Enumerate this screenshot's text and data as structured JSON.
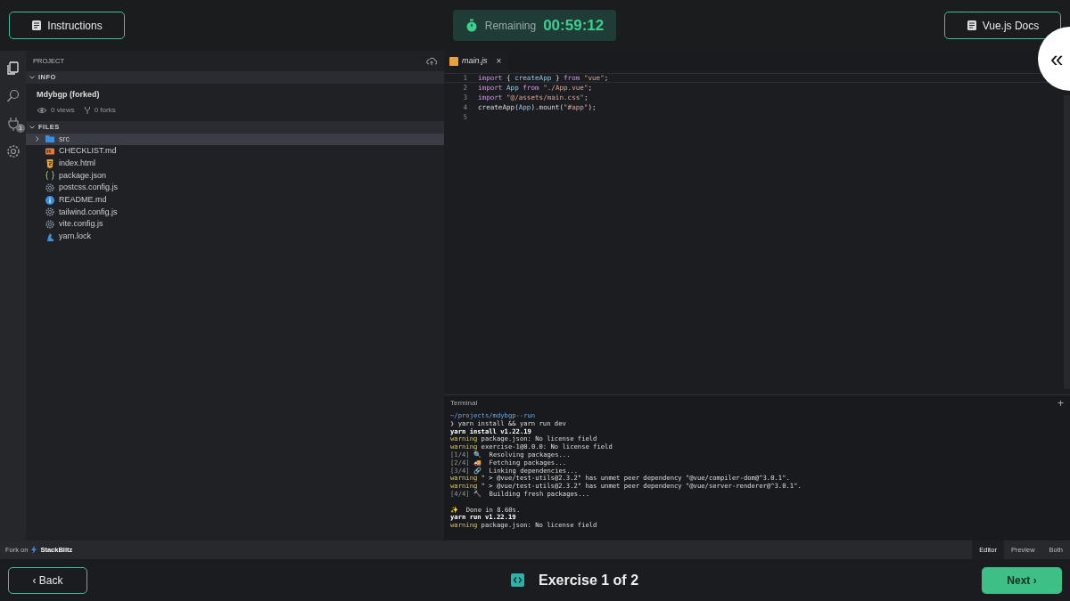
{
  "header": {
    "instructions_button": "Instructions",
    "timer_label": "Remaining",
    "timer_value": "00:59:12",
    "docs_button": "Vue.js Docs",
    "collapse_button": "«"
  },
  "activity_bar": [
    {
      "kind": "files",
      "selected": true
    },
    {
      "kind": "search",
      "selected": false
    },
    {
      "kind": "plug",
      "selected": false,
      "badge": "1"
    },
    {
      "kind": "settings",
      "selected": false
    }
  ],
  "explorer": {
    "title": "PROJECT",
    "sections": [
      {
        "label": "INFO",
        "expanded": true
      },
      {
        "label": "FILES",
        "expanded": true
      }
    ],
    "info": {
      "name": "Mdybgp (forked)",
      "views": "0 views",
      "forks": "0 forks"
    },
    "files": [
      {
        "name": "src",
        "kind": "folder",
        "expanded": false,
        "selected": true
      },
      {
        "name": "CHECKLIST.md",
        "kind": "markdown",
        "selected": false
      },
      {
        "name": "index.html",
        "kind": "html",
        "selected": false
      },
      {
        "name": "package.json",
        "kind": "json",
        "selected": false
      },
      {
        "name": "postcss.config.js",
        "kind": "config",
        "selected": false
      },
      {
        "name": "README.md",
        "kind": "info",
        "selected": false
      },
      {
        "name": "tailwind.config.js",
        "kind": "config",
        "selected": false
      },
      {
        "name": "vite.config.js",
        "kind": "config",
        "selected": false
      },
      {
        "name": "yarn.lock",
        "kind": "yarn",
        "selected": false
      }
    ]
  },
  "editor": {
    "tabs": [
      {
        "label": "main.js",
        "selected": true,
        "close": "×"
      }
    ],
    "lines": [
      {
        "number": "1",
        "tokens": [
          {
            "kind": "keyword",
            "text": "import"
          },
          {
            "kind": "plain",
            "text": " { "
          },
          {
            "kind": "name",
            "text": "createApp"
          },
          {
            "kind": "plain",
            "text": " } "
          },
          {
            "kind": "keyword",
            "text": "from"
          },
          {
            "kind": "string",
            "text": " \"vue\""
          },
          {
            "kind": "plain",
            "text": ";"
          }
        ]
      },
      {
        "number": "2",
        "tokens": [
          {
            "kind": "keyword",
            "text": "import"
          },
          {
            "kind": "name",
            "text": " App"
          },
          {
            "kind": "keyword",
            "text": " from"
          },
          {
            "kind": "string",
            "text": " \"./App.vue\""
          },
          {
            "kind": "plain",
            "text": ";"
          }
        ]
      },
      {
        "number": "3",
        "tokens": [
          {
            "kind": "keyword",
            "text": "import"
          },
          {
            "kind": "string",
            "text": " \"@/assets/main.css\""
          },
          {
            "kind": "plain",
            "text": ";"
          }
        ]
      },
      {
        "number": "4",
        "tokens": [
          {
            "kind": "plain",
            "text": "createApp("
          },
          {
            "kind": "name",
            "text": "App"
          },
          {
            "kind": "plain",
            "text": ").mount("
          },
          {
            "kind": "string",
            "text": "\"#app\""
          },
          {
            "kind": "plain",
            "text": ");"
          }
        ]
      },
      {
        "number": "5"
      }
    ]
  },
  "terminal": {
    "title": "Terminal",
    "add_button": "+",
    "lines": [
      {
        "tokens": [
          {
            "kind": "path",
            "text": "~/projects/mdybgp--run"
          }
        ]
      },
      {
        "tokens": [
          {
            "kind": "prompt",
            "text": "❯"
          },
          {
            "kind": "plain",
            "text": " yarn install && yarn run dev"
          }
        ]
      },
      {
        "tokens": [
          {
            "kind": "bold",
            "text": "yarn install v1.22.19"
          }
        ]
      },
      {
        "tokens": [
          {
            "kind": "warning",
            "text": "warning"
          },
          {
            "kind": "plain",
            "text": " package.json: No license field"
          }
        ]
      },
      {
        "tokens": [
          {
            "kind": "warning",
            "text": "warning"
          },
          {
            "kind": "plain",
            "text": " exercise-1@0.0.0: No license field"
          }
        ]
      },
      {
        "tokens": [
          {
            "kind": "dim",
            "text": "[1/4]"
          },
          {
            "kind": "plain",
            "text": " 🔍  Resolving packages..."
          }
        ]
      },
      {
        "tokens": [
          {
            "kind": "dim",
            "text": "[2/4]"
          },
          {
            "kind": "plain",
            "text": " 🚚  Fetching packages..."
          }
        ]
      },
      {
        "tokens": [
          {
            "kind": "dim",
            "text": "[3/4]"
          },
          {
            "kind": "plain",
            "text": " 🔗  Linking dependencies..."
          }
        ]
      },
      {
        "tokens": [
          {
            "kind": "warning",
            "text": "warning"
          },
          {
            "kind": "plain",
            "text": " \" > @vue/test-utils@2.3.2\" has unmet peer dependency \"@vue/compiler-dom@^3.0.1\"."
          }
        ]
      },
      {
        "tokens": [
          {
            "kind": "warning",
            "text": "warning"
          },
          {
            "kind": "plain",
            "text": " \" > @vue/test-utils@2.3.2\" has unmet peer dependency \"@vue/server-renderer@^3.0.1\"."
          }
        ]
      },
      {
        "tokens": [
          {
            "kind": "dim",
            "text": "[4/4]"
          },
          {
            "kind": "plain",
            "text": " 🔨  Building fresh packages..."
          }
        ]
      },
      {
        "kind": "blank"
      },
      {
        "tokens": [
          {
            "kind": "plain",
            "text": "✨  Done in 8.60s."
          }
        ]
      },
      {
        "tokens": [
          {
            "kind": "bold",
            "text": "yarn run v1.22.19"
          }
        ]
      },
      {
        "tokens": [
          {
            "kind": "warning",
            "text": "warning"
          },
          {
            "kind": "plain",
            "text": " package.json: No license field"
          }
        ]
      }
    ]
  },
  "status_bar": {
    "fork_label": "Fork on",
    "brand": "StackBlitz",
    "view_tabs": [
      {
        "label": "Editor",
        "selected": true
      },
      {
        "label": "Preview",
        "selected": false
      },
      {
        "label": "Both",
        "selected": false
      }
    ]
  },
  "footer": {
    "back_button": "‹ Back",
    "exercise_title": "Exercise 1 of 2",
    "next_button": "Next ›"
  }
}
